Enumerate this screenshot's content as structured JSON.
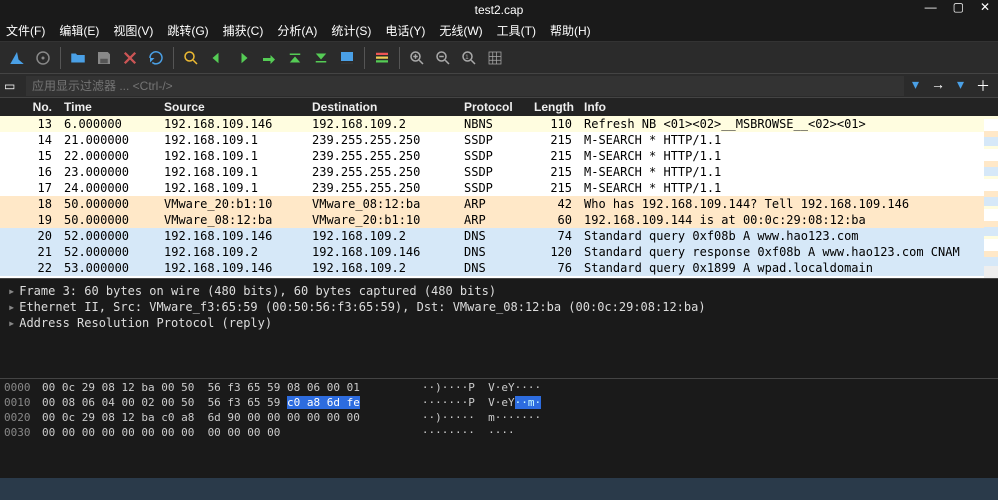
{
  "title": "test2.cap",
  "menu": [
    "文件(F)",
    "编辑(E)",
    "视图(V)",
    "跳转(G)",
    "捕获(C)",
    "分析(A)",
    "统计(S)",
    "电话(Y)",
    "无线(W)",
    "工具(T)",
    "帮助(H)"
  ],
  "filter_placeholder": "应用显示过滤器 ... <Ctrl-/>",
  "columns": {
    "no": "No.",
    "time": "Time",
    "src": "Source",
    "dst": "Destination",
    "proto": "Protocol",
    "len": "Length",
    "info": "Info"
  },
  "packets": [
    {
      "no": 13,
      "time": "6.000000",
      "src": "192.168.109.146",
      "dst": "192.168.109.2",
      "proto": "NBNS",
      "len": 110,
      "info": "Refresh NB <01><02>__MSBROWSE__<02><01>",
      "bg": "yellow"
    },
    {
      "no": 14,
      "time": "21.000000",
      "src": "192.168.109.1",
      "dst": "239.255.255.250",
      "proto": "SSDP",
      "len": 215,
      "info": "M-SEARCH * HTTP/1.1",
      "bg": "white"
    },
    {
      "no": 15,
      "time": "22.000000",
      "src": "192.168.109.1",
      "dst": "239.255.255.250",
      "proto": "SSDP",
      "len": 215,
      "info": "M-SEARCH * HTTP/1.1",
      "bg": "white"
    },
    {
      "no": 16,
      "time": "23.000000",
      "src": "192.168.109.1",
      "dst": "239.255.255.250",
      "proto": "SSDP",
      "len": 215,
      "info": "M-SEARCH * HTTP/1.1",
      "bg": "white"
    },
    {
      "no": 17,
      "time": "24.000000",
      "src": "192.168.109.1",
      "dst": "239.255.255.250",
      "proto": "SSDP",
      "len": 215,
      "info": "M-SEARCH * HTTP/1.1",
      "bg": "white"
    },
    {
      "no": 18,
      "time": "50.000000",
      "src": "VMware_20:b1:10",
      "dst": "VMware_08:12:ba",
      "proto": "ARP",
      "len": 42,
      "info": "Who has 192.168.109.144? Tell 192.168.109.146",
      "bg": "peach"
    },
    {
      "no": 19,
      "time": "50.000000",
      "src": "VMware_08:12:ba",
      "dst": "VMware_20:b1:10",
      "proto": "ARP",
      "len": 60,
      "info": "192.168.109.144 is at 00:0c:29:08:12:ba",
      "bg": "peach"
    },
    {
      "no": 20,
      "time": "52.000000",
      "src": "192.168.109.146",
      "dst": "192.168.109.2",
      "proto": "DNS",
      "len": 74,
      "info": "Standard query 0xf08b A www.hao123.com",
      "bg": "blue"
    },
    {
      "no": 21,
      "time": "52.000000",
      "src": "192.168.109.2",
      "dst": "192.168.109.146",
      "proto": "DNS",
      "len": 120,
      "info": "Standard query response 0xf08b A www.hao123.com CNAM",
      "bg": "blue"
    },
    {
      "no": 22,
      "time": "53.000000",
      "src": "192.168.109.146",
      "dst": "192.168.109.2",
      "proto": "DNS",
      "len": 76,
      "info": "Standard query 0x1899 A wpad.localdomain",
      "bg": "blue"
    }
  ],
  "details": [
    "Frame 3: 60 bytes on wire (480 bits), 60 bytes captured (480 bits)",
    "Ethernet II, Src: VMware_f3:65:59 (00:50:56:f3:65:59), Dst: VMware_08:12:ba (00:0c:29:08:12:ba)",
    "Address Resolution Protocol (reply)"
  ],
  "hex": [
    {
      "off": "0000",
      "b1": "00 0c 29 08 12 ba 00 50",
      "b2": "  56 f3 65 59 08 06 00 01",
      "a": "··)····P  V·eY····"
    },
    {
      "off": "0010",
      "b1": "00 08 06 04 00 02 00 50",
      "b2": "  56 f3 65 59 ",
      "b2hl": "c0 a8 6d fe",
      "a": "·······P  V·eY",
      "ahl": "··m·"
    },
    {
      "off": "0020",
      "b1": "00 0c 29 08 12 ba c0 a8",
      "b2": "  6d 90 00 00 00 00 00 00",
      "a": "··)·····  m·······"
    },
    {
      "off": "0030",
      "b1": "00 00 00 00 00 00 00 00",
      "b2": "  00 00 00 00",
      "a": "········  ····"
    }
  ]
}
